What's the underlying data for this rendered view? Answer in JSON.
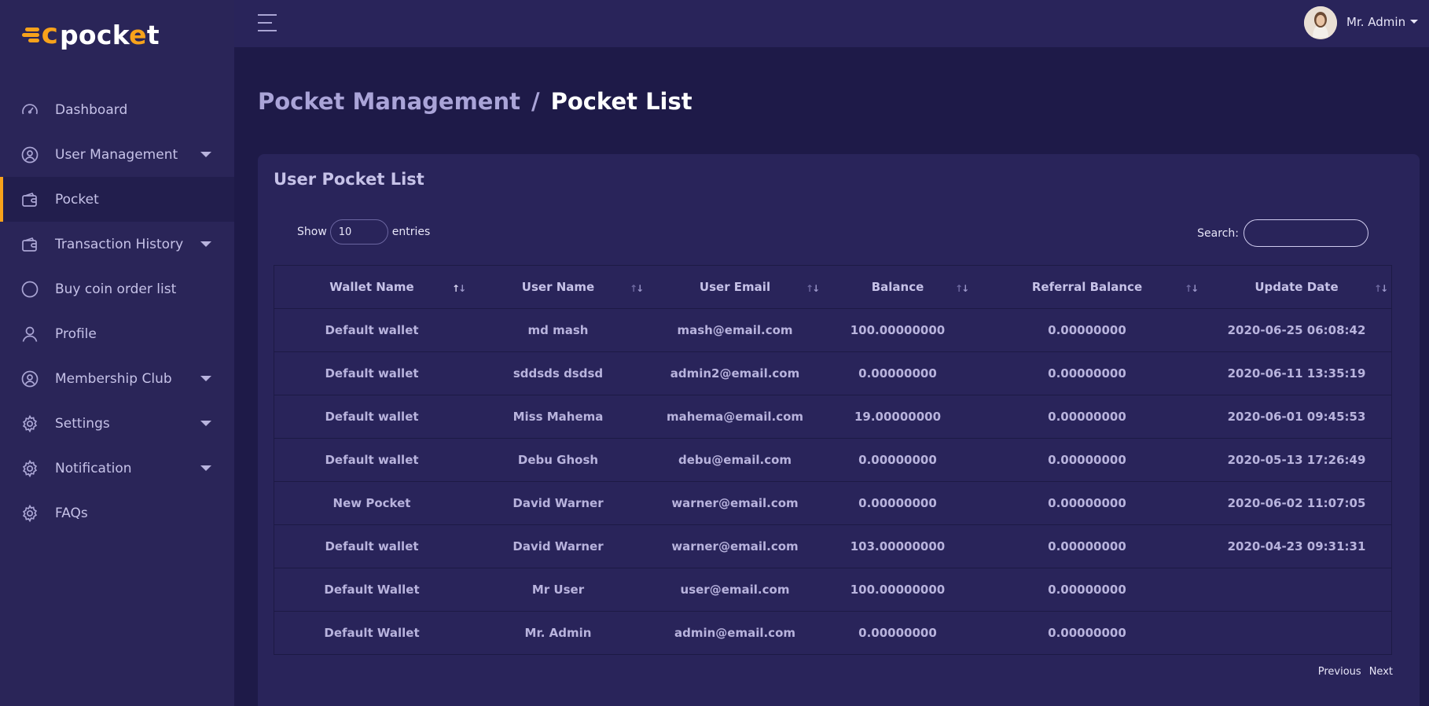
{
  "brand": {
    "name_prefix": "c",
    "name_main": "pock",
    "name_e": "e",
    "name_end": "t",
    "accent": "#f7a21b"
  },
  "sidebar": {
    "items": [
      {
        "label": "Dashboard",
        "icon": "gauge-icon",
        "has_submenu": false
      },
      {
        "label": "User Management",
        "icon": "user-circle-icon",
        "has_submenu": true
      },
      {
        "label": "Pocket",
        "icon": "wallet-icon",
        "has_submenu": false,
        "active": true
      },
      {
        "label": "Transaction History",
        "icon": "wallet-icon",
        "has_submenu": true
      },
      {
        "label": "Buy coin order list",
        "icon": "circle-icon",
        "has_submenu": false
      },
      {
        "label": "Profile",
        "icon": "person-icon",
        "has_submenu": false
      },
      {
        "label": "Membership Club",
        "icon": "user-circle-icon",
        "has_submenu": true
      },
      {
        "label": "Settings",
        "icon": "gear-icon",
        "has_submenu": true
      },
      {
        "label": "Notification",
        "icon": "gear-icon",
        "has_submenu": true
      },
      {
        "label": "FAQs",
        "icon": "gear-icon",
        "has_submenu": false
      }
    ]
  },
  "topbar": {
    "user_name": "Mr. Admin"
  },
  "breadcrumb": {
    "parent": "Pocket Management",
    "separator": "/",
    "current": "Pocket List"
  },
  "card": {
    "title": "User Pocket List",
    "show_label": "Show",
    "entries_value": "10",
    "entries_label": "entries",
    "search_label": "Search:"
  },
  "table": {
    "columns": [
      "Wallet Name",
      "User Name",
      "User Email",
      "Balance",
      "Referral Balance",
      "Update Date"
    ],
    "rows": [
      [
        "Default wallet",
        "md mash",
        "mash@email.com",
        "100.00000000",
        "0.00000000",
        "2020-06-25 06:08:42"
      ],
      [
        "Default wallet",
        "sddsds dsdsd",
        "admin2@email.com",
        "0.00000000",
        "0.00000000",
        "2020-06-11 13:35:19"
      ],
      [
        "Default wallet",
        "Miss Mahema",
        "mahema@email.com",
        "19.00000000",
        "0.00000000",
        "2020-06-01 09:45:53"
      ],
      [
        "Default wallet",
        "Debu Ghosh",
        "debu@email.com",
        "0.00000000",
        "0.00000000",
        "2020-05-13 17:26:49"
      ],
      [
        "New Pocket",
        "David Warner",
        "warner@email.com",
        "0.00000000",
        "0.00000000",
        "2020-06-02 11:07:05"
      ],
      [
        "Default wallet",
        "David Warner",
        "warner@email.com",
        "103.00000000",
        "0.00000000",
        "2020-04-23 09:31:31"
      ],
      [
        "Default Wallet",
        "Mr User",
        "user@email.com",
        "100.00000000",
        "0.00000000",
        ""
      ],
      [
        "Default Wallet",
        "Mr. Admin",
        "admin@email.com",
        "0.00000000",
        "0.00000000",
        ""
      ]
    ]
  },
  "pagination": {
    "previous": "Previous",
    "next": "Next"
  }
}
